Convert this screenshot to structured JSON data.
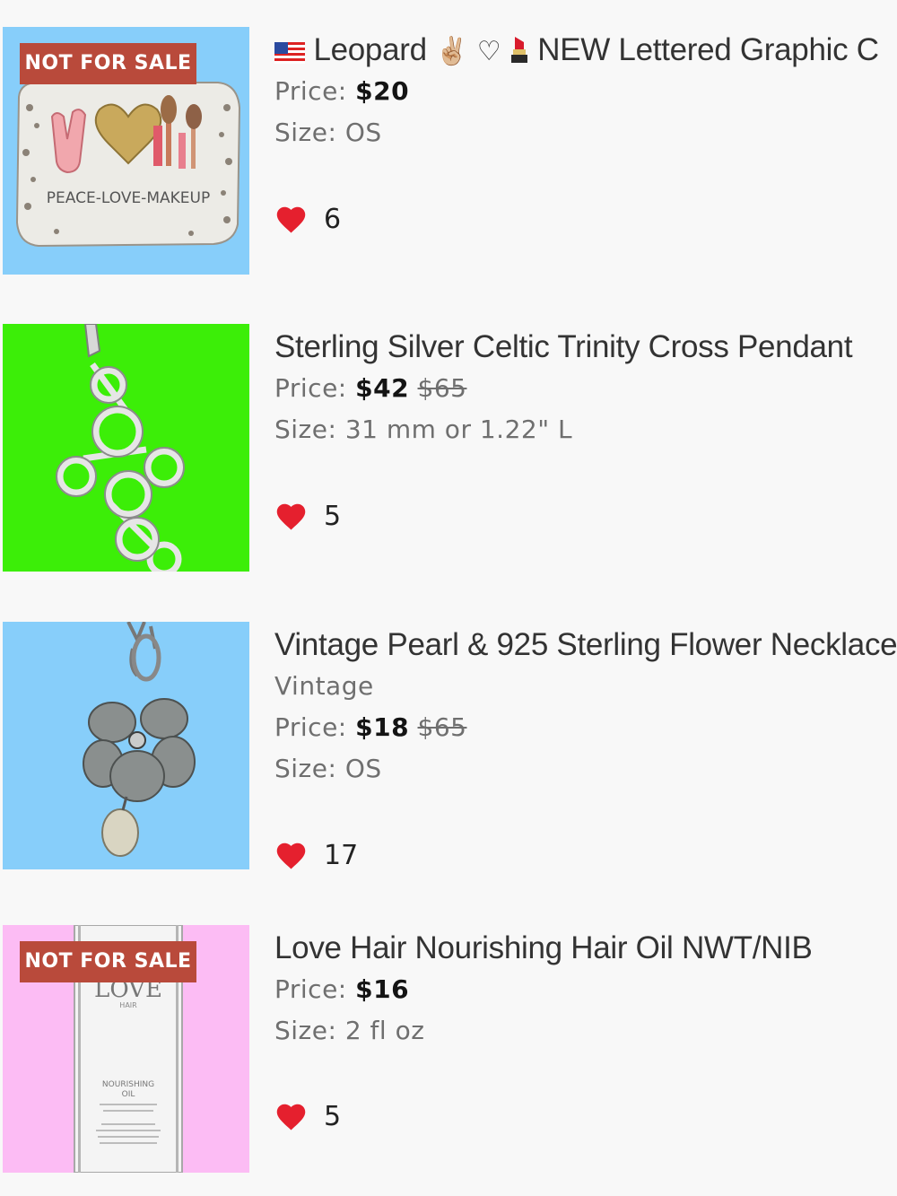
{
  "listings": [
    {
      "title_text": "Leopard",
      "title_emoji_1": "✌🏼",
      "title_emoji_2": "♡",
      "title_tail": "NEW Lettered Graphic C",
      "price_label": "Price:",
      "price": "$20",
      "size_label": "Size:",
      "size": "OS",
      "likes": "6",
      "badge": "NOT FOR SALE",
      "image_text": "PEACE-LOVE-MAKEUP",
      "thumb_color": "#87cefa"
    },
    {
      "title": "Sterling Silver Celtic Trinity Cross Pendant",
      "price_label": "Price:",
      "price": "$42",
      "original_price": "$65",
      "size_label": "Size:",
      "size": "31 mm or 1.22\" L",
      "likes": "5",
      "thumb_color": "#3cee08"
    },
    {
      "title": "Vintage Pearl & 925 Sterling Flower Necklace",
      "tag": "Vintage",
      "price_label": "Price:",
      "price": "$18",
      "original_price": "$65",
      "size_label": "Size:",
      "size": "OS",
      "likes": "17",
      "thumb_color": "#87cefa"
    },
    {
      "title": "Love Hair Nourishing Hair Oil NWT/NIB",
      "price_label": "Price:",
      "price": "$16",
      "size_label": "Size:",
      "size": "2 fl oz",
      "likes": "5",
      "badge": "NOT FOR SALE",
      "image_text_brand": "LOVE",
      "image_text_sub": "HAIR",
      "image_text_product": "NOURISHING",
      "image_text_product2": "OIL",
      "thumb_color": "#fcbcf4"
    }
  ],
  "colors": {
    "badge": "#b94a3b",
    "heart": "#e5202e",
    "background": "#f8f8f8"
  },
  "icons": [
    "us-flag-icon",
    "heart-icon",
    "lipstick-icon"
  ]
}
